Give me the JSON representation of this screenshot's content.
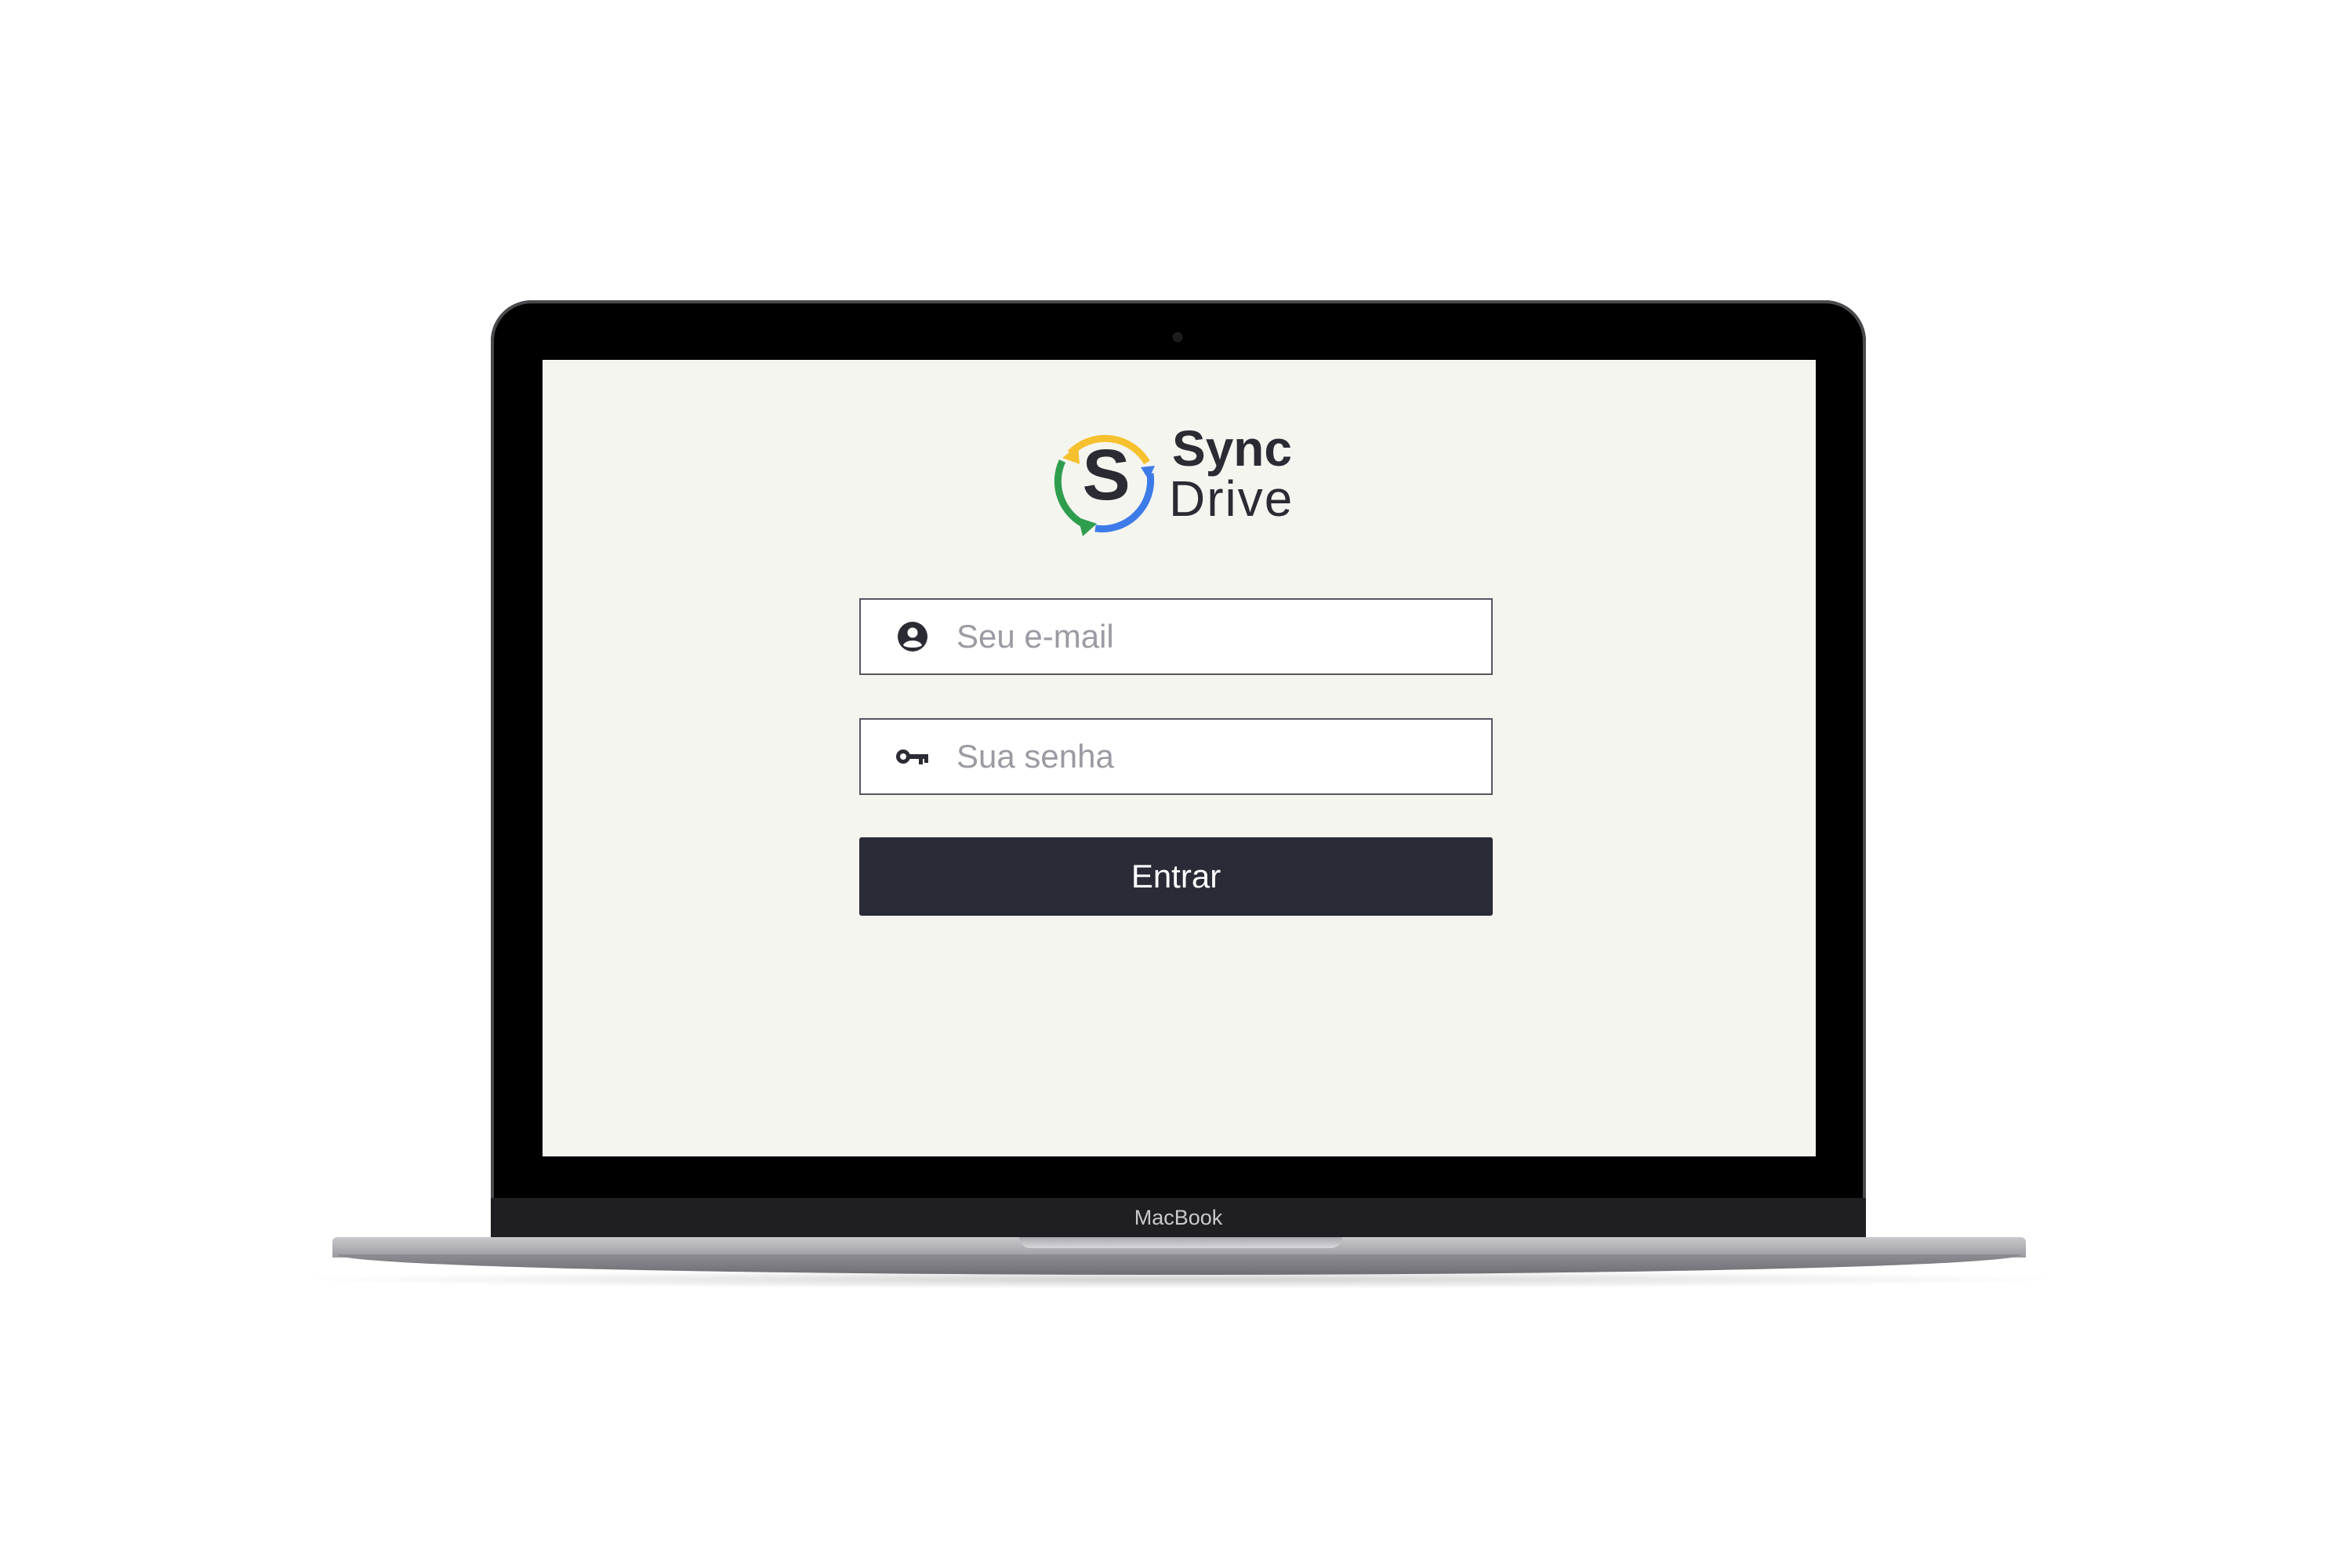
{
  "device": {
    "label": "MacBook"
  },
  "app": {
    "logo": {
      "line1": "Sync",
      "line2": "Drive",
      "letter": "S"
    },
    "email_field": {
      "placeholder": "Seu e-mail",
      "value": "",
      "icon": "user-circle-icon"
    },
    "password_field": {
      "placeholder": "Sua senha",
      "value": "",
      "icon": "key-icon"
    },
    "submit_button": {
      "label": "Entrar"
    }
  },
  "colors": {
    "screen_background": "#f5f5f0",
    "button": "#292b36",
    "logo_yellow": "#f5c12e",
    "logo_blue": "#3d7be8",
    "logo_green": "#2e9e4e"
  }
}
